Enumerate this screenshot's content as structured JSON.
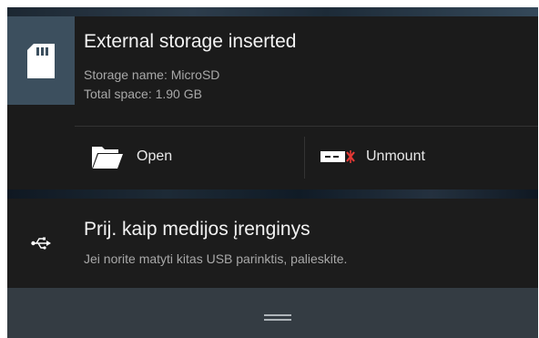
{
  "notifications": {
    "storage": {
      "icon": "sd-card-icon",
      "title": "External storage inserted",
      "storage_name": "Storage name: MicroSD",
      "total_space": "Total space: 1.90 GB",
      "actions": {
        "open": {
          "icon": "folder-icon",
          "label": "Open"
        },
        "unmount": {
          "icon": "unmount-icon",
          "label": "Unmount"
        }
      }
    },
    "usb": {
      "icon": "usb-icon",
      "title": "Prij. kaip medijos įrenginys",
      "text": "Jei norite matyti kitas USB parinktis, palieskite."
    }
  },
  "colors": {
    "card_bg": "#1b1b1b",
    "icon_tile_bg": "#3c4f5e",
    "unmount_accent": "#e53935"
  }
}
